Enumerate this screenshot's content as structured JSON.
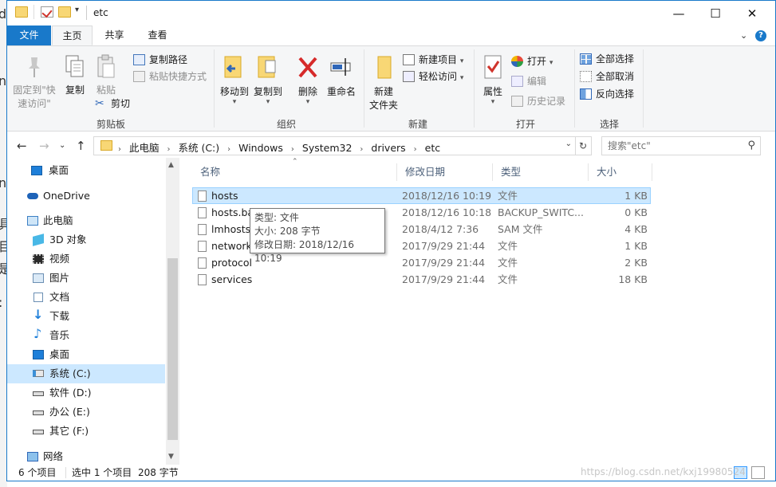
{
  "title": "etc",
  "tabs": [
    "文件",
    "主页",
    "共享",
    "查看"
  ],
  "ribbon": {
    "clipboard": {
      "pin": "固定到\"快\n速访问\"",
      "copy": "复制",
      "paste": "粘贴",
      "copy_path": "复制路径",
      "paste_shortcut": "粘贴快捷方式",
      "cut": "剪切",
      "label": "剪贴板"
    },
    "organize": {
      "move_to": "移动到",
      "copy_to": "复制到",
      "delete": "删除",
      "rename": "重命名",
      "label": "组织"
    },
    "new": {
      "new_folder": "新建\n文件夹",
      "new_item": "新建项目",
      "easy_access": "轻松访问",
      "label": "新建"
    },
    "open": {
      "properties": "属性",
      "open": "打开",
      "edit": "编辑",
      "history": "历史记录",
      "label": "打开"
    },
    "select": {
      "select_all": "全部选择",
      "select_none": "全部取消",
      "invert": "反向选择",
      "label": "选择"
    }
  },
  "address": {
    "crumbs": [
      "此电脑",
      "系统 (C:)",
      "Windows",
      "System32",
      "drivers",
      "etc"
    ],
    "search_placeholder": "搜索\"etc\""
  },
  "nav_pane": {
    "items": [
      {
        "label": "桌面",
        "icon": "desktop-icon"
      },
      {
        "label": "OneDrive",
        "icon": "onedrive-icon"
      },
      {
        "label": "此电脑",
        "icon": "pc-icon"
      },
      {
        "label": "3D 对象",
        "icon": "3d-objects-icon"
      },
      {
        "label": "视频",
        "icon": "video-icon"
      },
      {
        "label": "图片",
        "icon": "pictures-icon"
      },
      {
        "label": "文档",
        "icon": "documents-icon"
      },
      {
        "label": "下载",
        "icon": "downloads-icon"
      },
      {
        "label": "音乐",
        "icon": "music-icon"
      },
      {
        "label": "桌面",
        "icon": "desktop-icon"
      },
      {
        "label": "系统 (C:)",
        "icon": "system-drive-icon"
      },
      {
        "label": "软件 (D:)",
        "icon": "drive-icon"
      },
      {
        "label": "办公 (E:)",
        "icon": "drive-icon"
      },
      {
        "label": "其它 (F:)",
        "icon": "drive-icon"
      },
      {
        "label": "网络",
        "icon": "network-icon"
      }
    ]
  },
  "file_list": {
    "columns": [
      "名称",
      "修改日期",
      "类型",
      "大小"
    ],
    "rows": [
      {
        "name": "hosts",
        "date": "2018/12/16 10:19",
        "type": "文件",
        "size": "1 KB"
      },
      {
        "name": "hosts.backup.switchhosts",
        "date": "2018/12/16 10:18",
        "type": "BACKUP_SWITC...",
        "size": "0 KB"
      },
      {
        "name": "lmhosts.sam",
        "date": "2018/4/12 7:36",
        "type": "SAM 文件",
        "size": "4 KB"
      },
      {
        "name": "networks",
        "date": "2017/9/29 21:44",
        "type": "文件",
        "size": "1 KB"
      },
      {
        "name": "protocol",
        "date": "2017/9/29 21:44",
        "type": "文件",
        "size": "2 KB"
      },
      {
        "name": "services",
        "date": "2017/9/29 21:44",
        "type": "文件",
        "size": "18 KB"
      }
    ]
  },
  "tooltip": {
    "type": "类型: 文件",
    "size": "大小: 208 字节",
    "modified": "修改日期: 2018/12/16 10:19"
  },
  "status": {
    "count": "6 个项目",
    "selected": "选中 1 个项目",
    "size": "208 字节"
  },
  "watermark": "https://blog.csdn.net/kxj19980524",
  "colors": {
    "accent": "#1979ca",
    "selection": "#cce8ff",
    "selection_border": "#99d1ff"
  }
}
